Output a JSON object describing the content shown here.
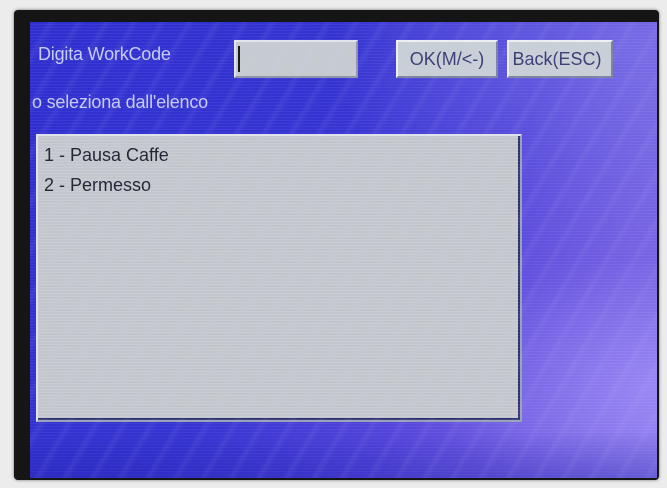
{
  "workcode": {
    "label": "Digita WorkCode",
    "input_value": "",
    "ok_button": "OK(M/<-)",
    "back_button": "Back(ESC)"
  },
  "list_prompt": "o seleziona dall'elenco",
  "list": {
    "items": [
      "1 - Pausa Caffe",
      "2 - Permesso"
    ]
  },
  "colors": {
    "screen_background": "#3534d2",
    "label_text": "#c7ccf2",
    "list_background": "#c3c7cd",
    "button_background": "#c9cfd6"
  }
}
